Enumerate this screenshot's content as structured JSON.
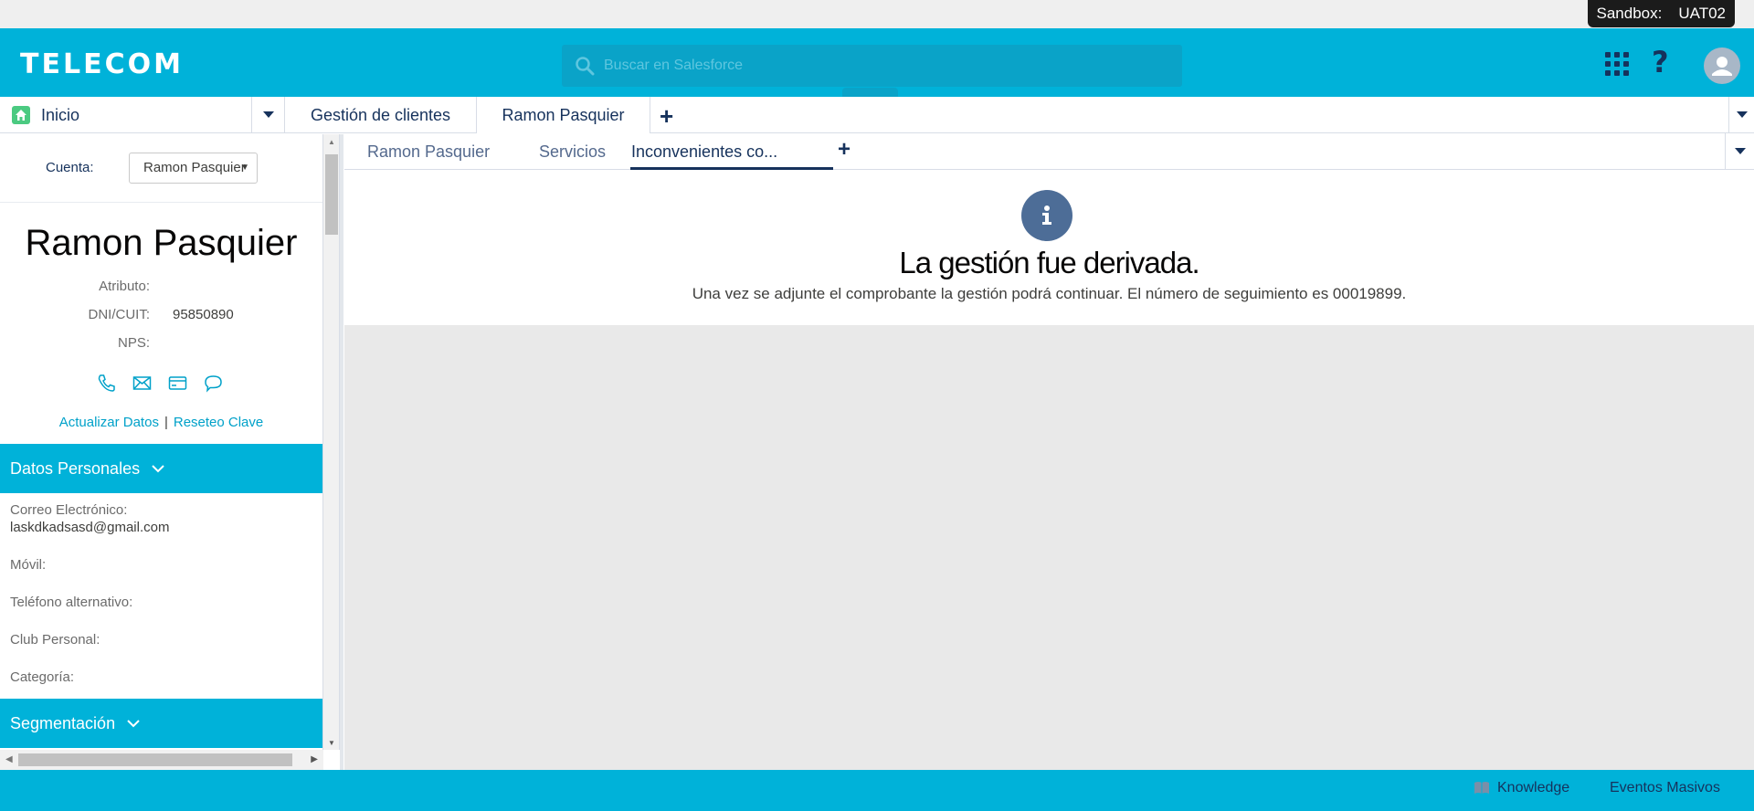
{
  "sandbox": {
    "label": "Sandbox:",
    "name": "UAT02"
  },
  "header": {
    "logo": "TELECOM",
    "search_placeholder": "Buscar en Salesforce",
    "help_label": "?"
  },
  "primary_tabs": {
    "home_label": "Inicio",
    "tabs": [
      "Gestión de clientes",
      "Ramon Pasquier"
    ],
    "add_label": "+"
  },
  "left_panel": {
    "cuenta_label": "Cuenta:",
    "cuenta_value": "Ramon Pasquier",
    "client_name": "Ramon Pasquier",
    "attributes": [
      {
        "label": "Atributo:",
        "value": ""
      },
      {
        "label": "DNI/CUIT:",
        "value": "95850890"
      },
      {
        "label": "NPS:",
        "value": ""
      }
    ],
    "contact_icons": [
      "phone-icon",
      "email-icon",
      "card-icon",
      "chat-icon"
    ],
    "link_update": "Actualizar Datos",
    "link_separator": "|",
    "link_reset": "Reseteo Clave",
    "section_personal": "Datos Personales",
    "fields": [
      {
        "label": "Correo Electrónico:",
        "value": "laskdkadsasd@gmail.com"
      },
      {
        "label": "Móvil:",
        "value": ""
      },
      {
        "label": "Teléfono alternativo:",
        "value": ""
      },
      {
        "label": "Club Personal:",
        "value": ""
      },
      {
        "label": "Categoría:",
        "value": ""
      }
    ],
    "section_segmentacion": "Segmentación"
  },
  "sub_tabs": {
    "tabs": [
      "Ramon Pasquier",
      "Servicios",
      "Inconvenientes co..."
    ],
    "active_index": 2,
    "add_label": "+"
  },
  "message": {
    "icon": "info-icon",
    "title": "La gestión fue derivada.",
    "text": "Una vez se adjunte el comprobante la gestión podrá continuar. El número de seguimiento es 00019899."
  },
  "footer": {
    "knowledge_label": "Knowledge",
    "eventos_label": "Eventos Masivos"
  },
  "colors": {
    "brand": "#00b2d9",
    "navy": "#16325c",
    "link": "#00a1c9",
    "info_icon_bg": "#4d6d97"
  }
}
